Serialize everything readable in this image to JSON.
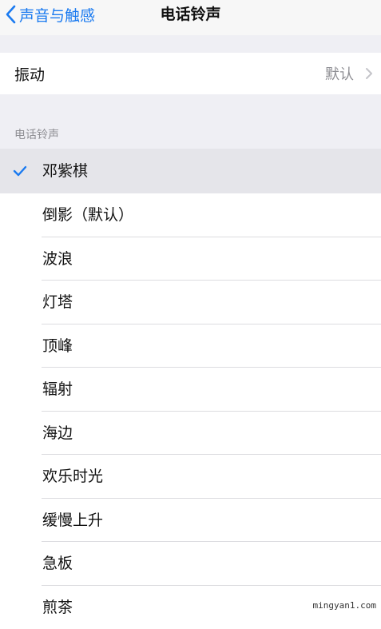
{
  "nav": {
    "back_label": "声音与触感",
    "title": "电话铃声"
  },
  "vibration": {
    "label": "振动",
    "value": "默认"
  },
  "ringtones": {
    "section_header": "电话铃声",
    "selected_index": 0,
    "items": [
      {
        "label": "邓紫棋"
      },
      {
        "label": "倒影（默认）"
      },
      {
        "label": "波浪"
      },
      {
        "label": "灯塔"
      },
      {
        "label": "顶峰"
      },
      {
        "label": "辐射"
      },
      {
        "label": "海边"
      },
      {
        "label": "欢乐时光"
      },
      {
        "label": "缓慢上升"
      },
      {
        "label": "急板"
      },
      {
        "label": "煎茶"
      }
    ]
  },
  "watermark": "mingyan1.com",
  "colors": {
    "accent": "#1a7af0",
    "background": "#efeff4",
    "selected_row": "#e5e5ea"
  },
  "icons": {
    "back": "chevron-left-icon",
    "disclosure": "chevron-right-icon",
    "selected": "checkmark-icon"
  }
}
